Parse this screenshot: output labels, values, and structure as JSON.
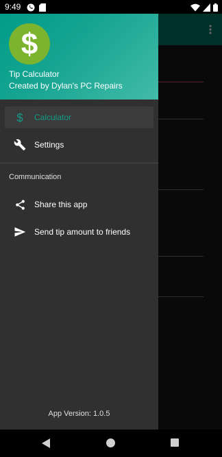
{
  "status_bar": {
    "time": "9:49",
    "icons_left": [
      "whatsapp-icon",
      "sd-card-icon"
    ],
    "icons_right": [
      "wifi-icon",
      "signal-icon",
      "battery-icon"
    ]
  },
  "header": {
    "app_name": "Tip Calculator",
    "subtitle": "Created by Dylan's PC Repairs",
    "logo_icon": "dollar-icon",
    "gradient_colors": [
      "#009c88",
      "#43bba9"
    ],
    "logo_color": "#7db42f"
  },
  "nav": {
    "items": [
      {
        "label": "Calculator",
        "icon": "dollar-icon",
        "active": true
      },
      {
        "label": "Settings",
        "icon": "wrench-icon",
        "active": false
      }
    ],
    "section_title": "Communication",
    "communication_items": [
      {
        "label": "Share this app",
        "icon": "share-icon"
      },
      {
        "label": "Send tip amount to friends",
        "icon": "send-icon"
      }
    ]
  },
  "footer": {
    "version": "App Version: 1.0.5"
  },
  "theme": {
    "accent": "#129c89",
    "drawer_bg": "#303030",
    "toolbar": "#00584e"
  },
  "system_nav": {
    "buttons": [
      "back-icon",
      "home-icon",
      "recents-icon"
    ]
  }
}
